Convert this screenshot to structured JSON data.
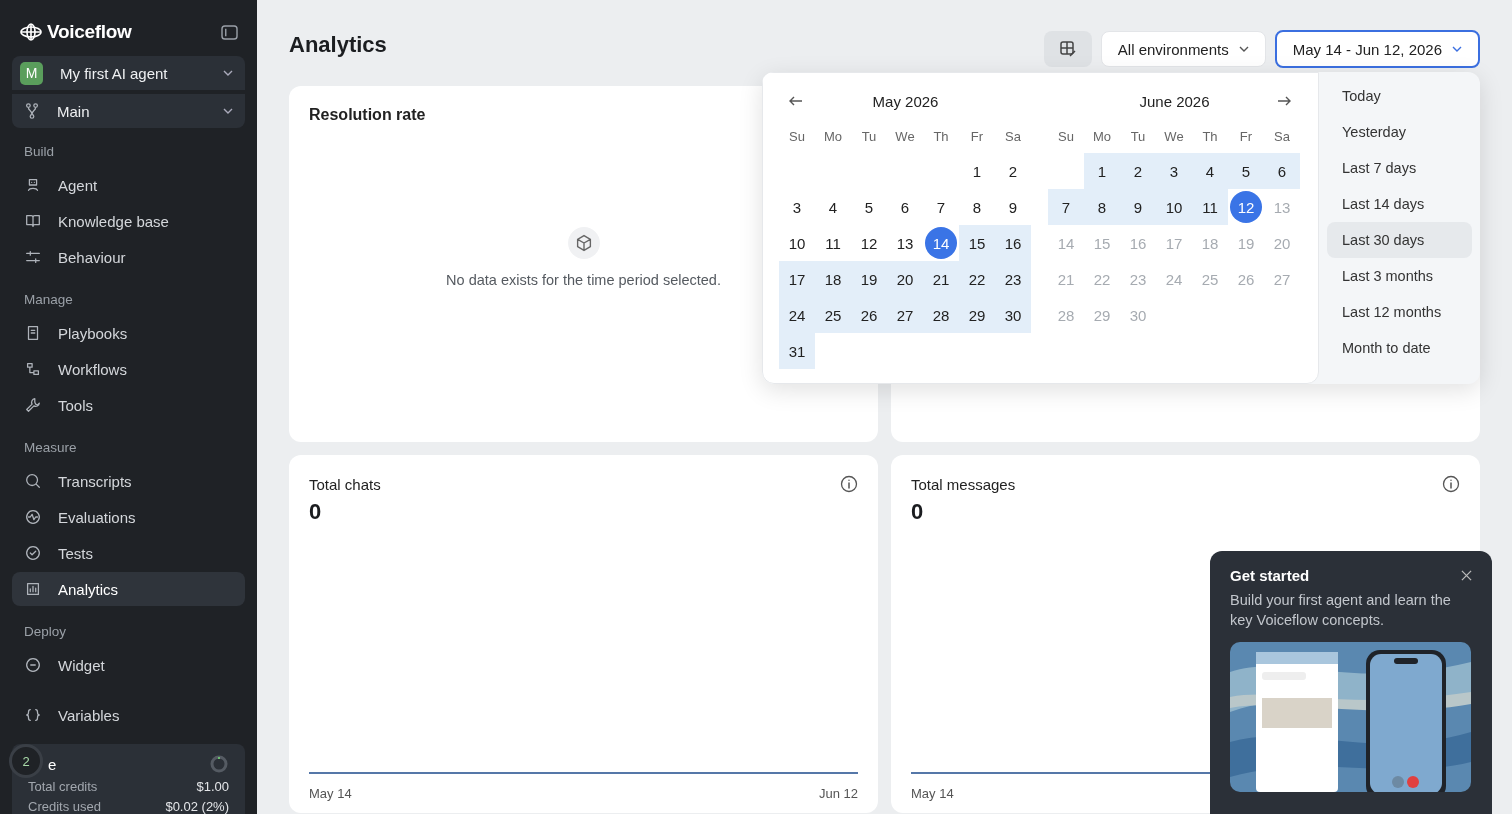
{
  "sidebar": {
    "logo": "Voiceflow",
    "agent": {
      "initial": "M",
      "name": "My first AI agent"
    },
    "branch": "Main",
    "sections": [
      {
        "title": "Build",
        "items": [
          {
            "label": "Agent",
            "selected": false
          },
          {
            "label": "Knowledge base",
            "selected": false
          },
          {
            "label": "Behaviour",
            "selected": false
          }
        ]
      },
      {
        "title": "Manage",
        "items": [
          {
            "label": "Playbooks",
            "selected": false
          },
          {
            "label": "Workflows",
            "selected": false
          },
          {
            "label": "Tools",
            "selected": false
          }
        ]
      },
      {
        "title": "Measure",
        "items": [
          {
            "label": "Transcripts",
            "selected": false
          },
          {
            "label": "Evaluations",
            "selected": false
          },
          {
            "label": "Tests",
            "selected": false
          },
          {
            "label": "Analytics",
            "selected": true
          }
        ]
      },
      {
        "title": "Deploy",
        "items": [
          {
            "label": "Widget",
            "selected": false
          }
        ]
      },
      {
        "items": [
          {
            "label": "Variables",
            "selected": false
          }
        ]
      }
    ],
    "credits": {
      "badge": "2",
      "label": "e",
      "rows": [
        {
          "label": "Total credits",
          "value": "$1.00"
        },
        {
          "label": "Credits used",
          "value": "$0.02 (2%)"
        }
      ]
    }
  },
  "header": {
    "title": "Analytics",
    "environment": "All environments",
    "date_range": "May 14 - Jun 12, 2026"
  },
  "date_picker": {
    "months": [
      {
        "title": "May 2026",
        "weekdays": [
          "Su",
          "Mo",
          "Tu",
          "We",
          "Th",
          "Fr",
          "Sa"
        ],
        "weeks": [
          [
            {
              "d": "1",
              "in_range": false,
              "selected": false,
              "disabled": false
            },
            {
              "d": "2",
              "in_range": false,
              "selected": false,
              "disabled": false
            }
          ],
          [
            {
              "d": "3",
              "in_range": false,
              "selected": false,
              "disabled": false
            },
            {
              "d": "4",
              "in_range": false,
              "selected": false,
              "disabled": false
            },
            {
              "d": "5",
              "in_range": false,
              "selected": false,
              "disabled": false
            },
            {
              "d": "6",
              "in_range": false,
              "selected": false,
              "disabled": false
            },
            {
              "d": "7",
              "in_range": false,
              "selected": false,
              "disabled": false
            },
            {
              "d": "8",
              "in_range": false,
              "selected": false,
              "disabled": false
            },
            {
              "d": "9",
              "in_range": false,
              "selected": false,
              "disabled": false
            }
          ],
          [
            {
              "d": "10",
              "in_range": false,
              "selected": false,
              "disabled": false
            },
            {
              "d": "11",
              "in_range": false,
              "selected": false,
              "disabled": false
            },
            {
              "d": "12",
              "in_range": false,
              "selected": false,
              "disabled": false
            },
            {
              "d": "13",
              "in_range": false,
              "selected": false,
              "disabled": false
            },
            {
              "d": "14",
              "in_range": false,
              "selected": true,
              "disabled": false
            },
            {
              "d": "15",
              "in_range": true,
              "selected": false,
              "disabled": false
            },
            {
              "d": "16",
              "in_range": true,
              "selected": false,
              "disabled": false
            }
          ],
          [
            {
              "d": "17",
              "in_range": true,
              "selected": false,
              "disabled": false
            },
            {
              "d": "18",
              "in_range": true,
              "selected": false,
              "disabled": false
            },
            {
              "d": "19",
              "in_range": true,
              "selected": false,
              "disabled": false
            },
            {
              "d": "20",
              "in_range": true,
              "selected": false,
              "disabled": false
            },
            {
              "d": "21",
              "in_range": true,
              "selected": false,
              "disabled": false
            },
            {
              "d": "22",
              "in_range": true,
              "selected": false,
              "disabled": false
            },
            {
              "d": "23",
              "in_range": true,
              "selected": false,
              "disabled": false
            }
          ],
          [
            {
              "d": "24",
              "in_range": true,
              "selected": false,
              "disabled": false
            },
            {
              "d": "25",
              "in_range": true,
              "selected": false,
              "disabled": false
            },
            {
              "d": "26",
              "in_range": true,
              "selected": false,
              "disabled": false
            },
            {
              "d": "27",
              "in_range": true,
              "selected": false,
              "disabled": false
            },
            {
              "d": "28",
              "in_range": true,
              "selected": false,
              "disabled": false
            },
            {
              "d": "29",
              "in_range": true,
              "selected": false,
              "disabled": false
            },
            {
              "d": "30",
              "in_range": true,
              "selected": false,
              "disabled": false
            }
          ],
          [
            {
              "d": "31",
              "in_range": true,
              "selected": false,
              "disabled": false
            }
          ]
        ]
      },
      {
        "title": "June 2026",
        "weekdays": [
          "Su",
          "Mo",
          "Tu",
          "We",
          "Th",
          "Fr",
          "Sa"
        ],
        "weeks": [
          [
            {
              "d": "1",
              "in_range": true,
              "selected": false,
              "disabled": false
            },
            {
              "d": "2",
              "in_range": true,
              "selected": false,
              "disabled": false
            },
            {
              "d": "3",
              "in_range": true,
              "selected": false,
              "disabled": false
            },
            {
              "d": "4",
              "in_range": true,
              "selected": false,
              "disabled": false
            },
            {
              "d": "5",
              "in_range": true,
              "selected": false,
              "disabled": false
            },
            {
              "d": "6",
              "in_range": true,
              "selected": false,
              "disabled": false
            }
          ],
          [
            {
              "d": "7",
              "in_range": true,
              "selected": false,
              "disabled": false
            },
            {
              "d": "8",
              "in_range": true,
              "selected": false,
              "disabled": false
            },
            {
              "d": "9",
              "in_range": true,
              "selected": false,
              "disabled": false
            },
            {
              "d": "10",
              "in_range": true,
              "selected": false,
              "disabled": false
            },
            {
              "d": "11",
              "in_range": true,
              "selected": false,
              "disabled": false
            },
            {
              "d": "12",
              "in_range": false,
              "selected": true,
              "disabled": false
            },
            {
              "d": "13",
              "in_range": false,
              "selected": false,
              "disabled": true
            }
          ],
          [
            {
              "d": "14",
              "in_range": false,
              "selected": false,
              "disabled": true
            },
            {
              "d": "15",
              "in_range": false,
              "selected": false,
              "disabled": true
            },
            {
              "d": "16",
              "in_range": false,
              "selected": false,
              "disabled": true
            },
            {
              "d": "17",
              "in_range": false,
              "selected": false,
              "disabled": true
            },
            {
              "d": "18",
              "in_range": false,
              "selected": false,
              "disabled": true
            },
            {
              "d": "19",
              "in_range": false,
              "selected": false,
              "disabled": true
            },
            {
              "d": "20",
              "in_range": false,
              "selected": false,
              "disabled": true
            }
          ],
          [
            {
              "d": "21",
              "in_range": false,
              "selected": false,
              "disabled": true
            },
            {
              "d": "22",
              "in_range": false,
              "selected": false,
              "disabled": true
            },
            {
              "d": "23",
              "in_range": false,
              "selected": false,
              "disabled": true
            },
            {
              "d": "24",
              "in_range": false,
              "selected": false,
              "disabled": true
            },
            {
              "d": "25",
              "in_range": false,
              "selected": false,
              "disabled": true
            },
            {
              "d": "26",
              "in_range": false,
              "selected": false,
              "disabled": true
            },
            {
              "d": "27",
              "in_range": false,
              "selected": false,
              "disabled": true
            }
          ],
          [
            {
              "d": "28",
              "in_range": false,
              "selected": false,
              "disabled": true
            },
            {
              "d": "29",
              "in_range": false,
              "selected": false,
              "disabled": true
            },
            {
              "d": "30",
              "in_range": false,
              "selected": false,
              "disabled": true
            }
          ]
        ]
      }
    ],
    "presets": [
      {
        "label": "Today",
        "selected": false
      },
      {
        "label": "Yesterday",
        "selected": false
      },
      {
        "label": "Last 7 days",
        "selected": false
      },
      {
        "label": "Last 14 days",
        "selected": false
      },
      {
        "label": "Last 30 days",
        "selected": true
      },
      {
        "label": "Last 3 months",
        "selected": false
      },
      {
        "label": "Last 12 months",
        "selected": false
      },
      {
        "label": "Month to date",
        "selected": false
      }
    ]
  },
  "cards": [
    {
      "kind": "empty",
      "title": "Resolution rate",
      "message": "No data exists for the time period selected."
    },
    {
      "kind": "blank"
    },
    {
      "kind": "metric",
      "title": "Total chats",
      "value": "0",
      "x_start": "May 14",
      "x_end": "Jun 12"
    },
    {
      "kind": "metric",
      "title": "Total messages",
      "value": "0",
      "x_start": "May 14"
    }
  ],
  "get_started": {
    "title": "Get started",
    "body": "Build your first agent and learn the key Voiceflow concepts."
  }
}
